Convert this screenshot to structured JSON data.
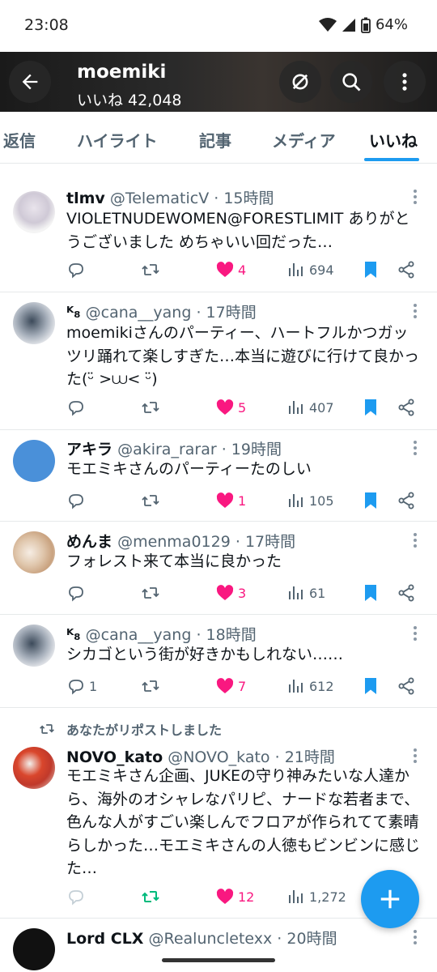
{
  "status_bar": {
    "time": "23:08",
    "battery": "64%"
  },
  "header": {
    "title": "moemiki",
    "likes_count": "いいね 42,048"
  },
  "tabs": [
    {
      "label": "返信",
      "active": false
    },
    {
      "label": "ハイライト",
      "active": false
    },
    {
      "label": "記事",
      "active": false
    },
    {
      "label": "メディア",
      "active": false
    },
    {
      "label": "いいね",
      "active": true
    }
  ],
  "posts": [
    {
      "name": "tlmv",
      "handle": "@TelematicV",
      "time": "15時間",
      "text": "VIOLETNUDEWOMEN@FORESTLIMIT ありがとうございました めちゃいい回だった…",
      "replies": "",
      "reposts": "",
      "likes": "4",
      "views": "694",
      "bookmarked": true
    },
    {
      "name": "ᴷ₈",
      "handle": "@cana__yang",
      "time": "17時間",
      "text": "moemikiさんのパーティー、ハートフルかつガッツリ踊れて楽しすぎた…本当に遊びに行けて良かった(ᵕ̈ >⩊< ᵕ̈)",
      "replies": "",
      "reposts": "",
      "likes": "5",
      "views": "407",
      "bookmarked": true
    },
    {
      "name": "アキラ",
      "handle": "@akira_rarar",
      "time": "19時間",
      "text": "モエミキさんのパーティーたのしい",
      "replies": "",
      "reposts": "",
      "likes": "1",
      "views": "105",
      "bookmarked": true
    },
    {
      "name": "めんま",
      "handle": "@menma0129",
      "time": "17時間",
      "text": "フォレスト来て本当に良かった",
      "replies": "",
      "reposts": "",
      "likes": "3",
      "views": "61",
      "bookmarked": true
    },
    {
      "name": "ᴷ₈",
      "handle": "@cana__yang",
      "time": "18時間",
      "text": "シカゴという街が好きかもしれない……",
      "replies": "1",
      "reposts": "",
      "likes": "7",
      "views": "612",
      "bookmarked": true
    },
    {
      "repost_banner": "あなたがリポストしました",
      "name": "NOVO_kato",
      "handle": "@NOVO_kato",
      "time": "21時間",
      "text": "モエミキさん企画、JUKEの守り神みたいな人達から、海外のオシャレなパリピ、ナードな若者まで、色んな人がすごい楽しんでフロアが作られてて素晴らしかった…モエミキさんの人徳もビンビンに感じた…",
      "replies": "",
      "reposts": "",
      "likes": "12",
      "views": "1,272",
      "bookmarked": false
    },
    {
      "name": "Lord CLX",
      "handle": "@Realuncletexx",
      "time": "20時間",
      "text": ""
    }
  ],
  "colors": {
    "accent": "#1d9bf0",
    "like": "#f91880",
    "repost_active": "#00ba7c",
    "secondary_text": "#536471"
  }
}
